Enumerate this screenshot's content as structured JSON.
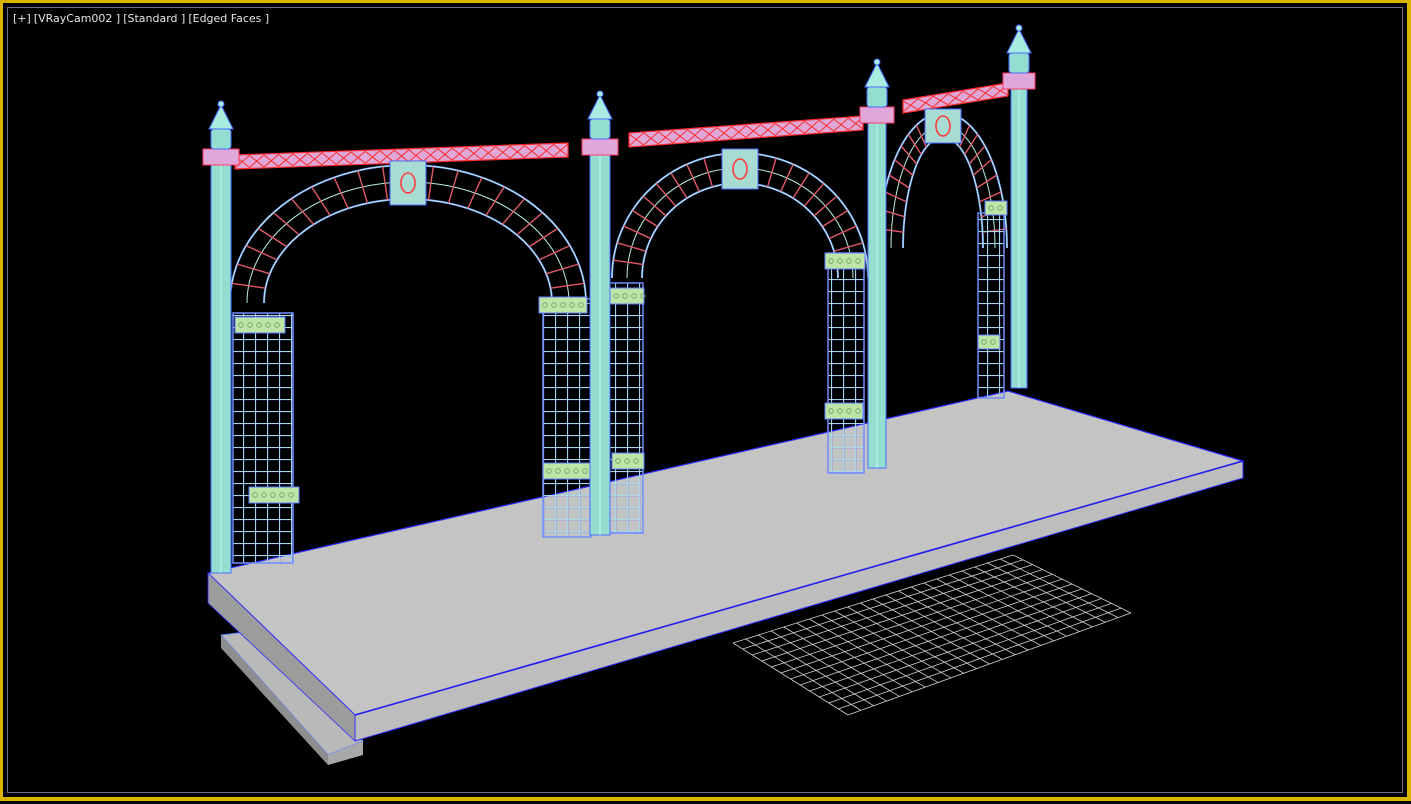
{
  "viewport": {
    "menu_label": "[+]",
    "camera_label": "[VRayCam002 ]",
    "shading_label": "[Standard ]",
    "display_label": "[Edged Faces ]"
  },
  "colors": {
    "frame": "#d8b400",
    "background": "#000000",
    "platform_top": "#c0c0c0",
    "platform_edge": "#2a2aff",
    "post": "#93ded0",
    "lattice": "#b8f0e4",
    "band": "#bde5a8",
    "beam": "#e0a8d8",
    "beam_outline": "#ff2a2a",
    "ground_grid": "#ffffff"
  }
}
